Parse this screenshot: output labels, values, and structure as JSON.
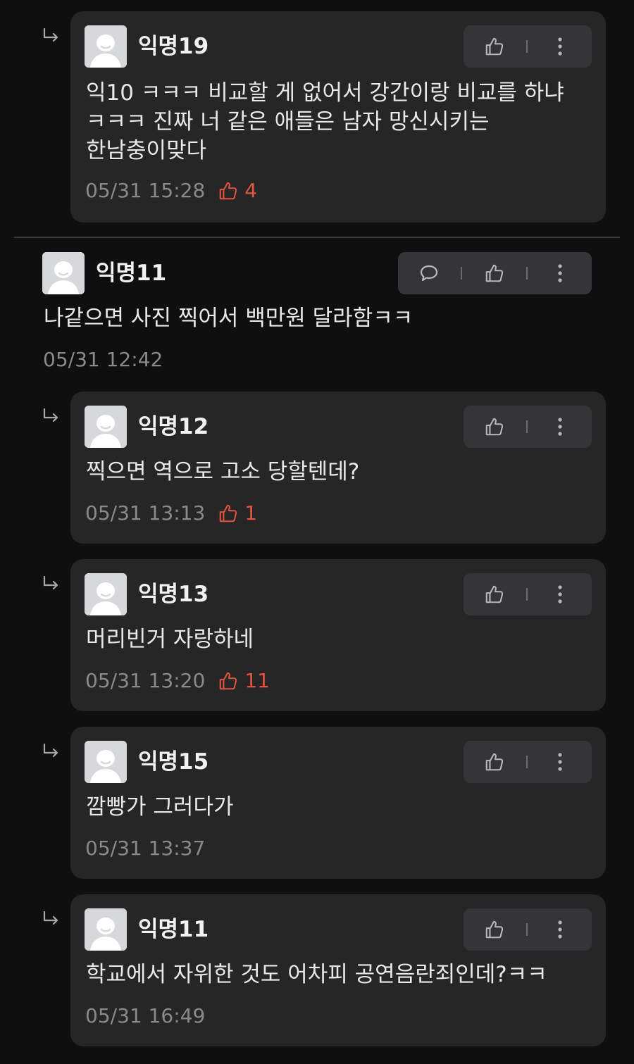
{
  "colors": {
    "background": "#0f0f10",
    "card": "#262627",
    "like_accent": "#e2543f",
    "meta_gray": "#8a8a8d"
  },
  "icons": {
    "reply_arrow": "reply-arrow-icon",
    "like": "thumbs-up-icon",
    "comment": "speech-bubble-icon",
    "more": "vertical-ellipsis-icon",
    "avatar": "default-avatar-icon"
  },
  "comments": [
    {
      "author": "익명19",
      "lines": [
        "익10 ㅋㅋㅋ 비교할 게 없어서 강간이랑 비교를 하냐",
        "ㅋㅋㅋ 진짜 너 같은 애들은 남자 망신시키는",
        "한남충이맞다"
      ],
      "time": "05/31 15:28",
      "likes": "4"
    },
    {
      "author": "익명11",
      "lines": [
        "나같으면 사진 찍어서 백만원 달라함ㅋㅋ"
      ],
      "time": "05/31 12:42"
    },
    {
      "author": "익명12",
      "lines": [
        "찍으면 역으로 고소 당할텐데?"
      ],
      "time": "05/31 13:13",
      "likes": "1"
    },
    {
      "author": "익명13",
      "lines": [
        "머리빈거 자랑하네"
      ],
      "time": "05/31 13:20",
      "likes": "11"
    },
    {
      "author": "익명15",
      "lines": [
        "깜빵가 그러다가"
      ],
      "time": "05/31 13:37"
    },
    {
      "author": "익명11",
      "lines": [
        "학교에서 자위한 것도 어차피 공연음란죄인데?ㅋㅋ"
      ],
      "time": "05/31 16:49"
    }
  ]
}
